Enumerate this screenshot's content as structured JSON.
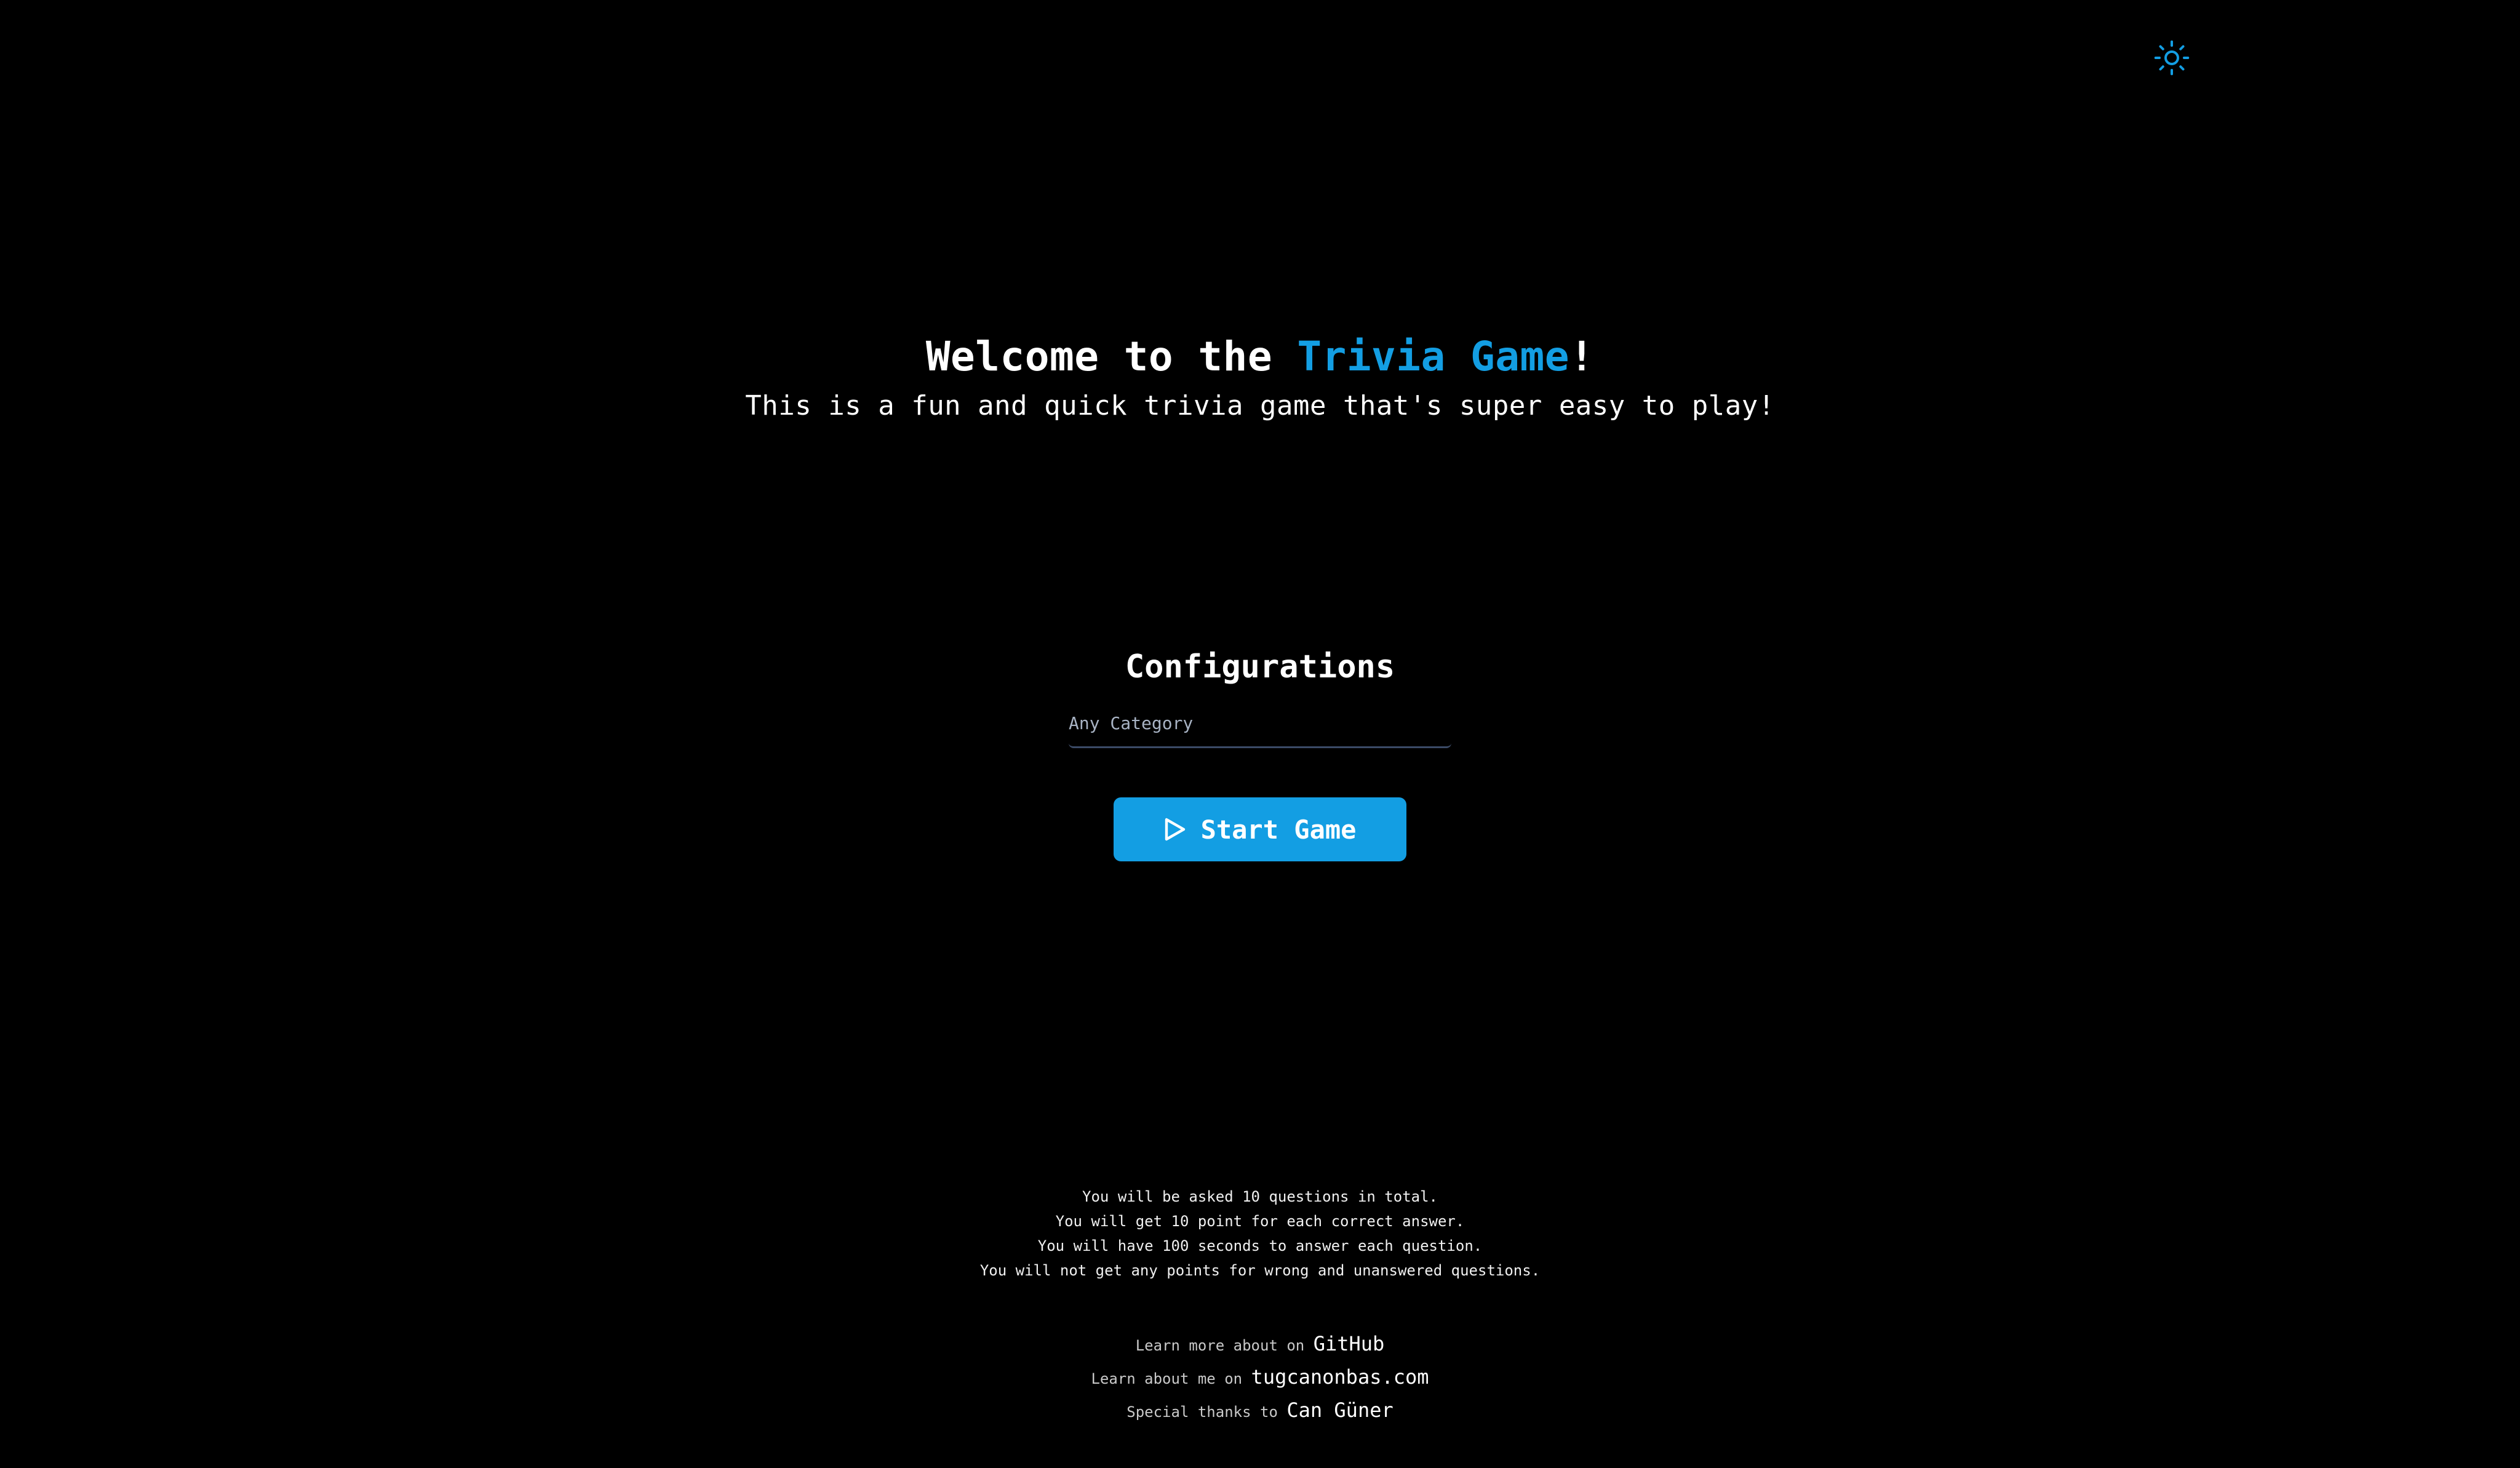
{
  "header": {
    "theme_toggle_icon": "sun-icon",
    "accent_color": "#139ee3"
  },
  "hero": {
    "title_prefix": "Welcome to the ",
    "title_highlight": "Trivia Game",
    "title_suffix": "!",
    "subtitle": "This is a fun and quick trivia game that's super easy to play!"
  },
  "config": {
    "title": "Configurations",
    "category_value": "Any Category"
  },
  "start_button": {
    "icon": "play-icon",
    "label": "Start Game",
    "background": "#139ee3"
  },
  "rules": [
    "You will be asked 10 questions in total.",
    "You will get 10 point for each correct answer.",
    "You will have 100 seconds to answer each question.",
    "You will not get any points for wrong and unanswered questions."
  ],
  "credits": [
    {
      "label": "Learn more about on ",
      "link": "GitHub"
    },
    {
      "label": "Learn about me on ",
      "link": "tugcanonbas.com"
    },
    {
      "label": "Special thanks to ",
      "link": "Can Güner"
    }
  ]
}
